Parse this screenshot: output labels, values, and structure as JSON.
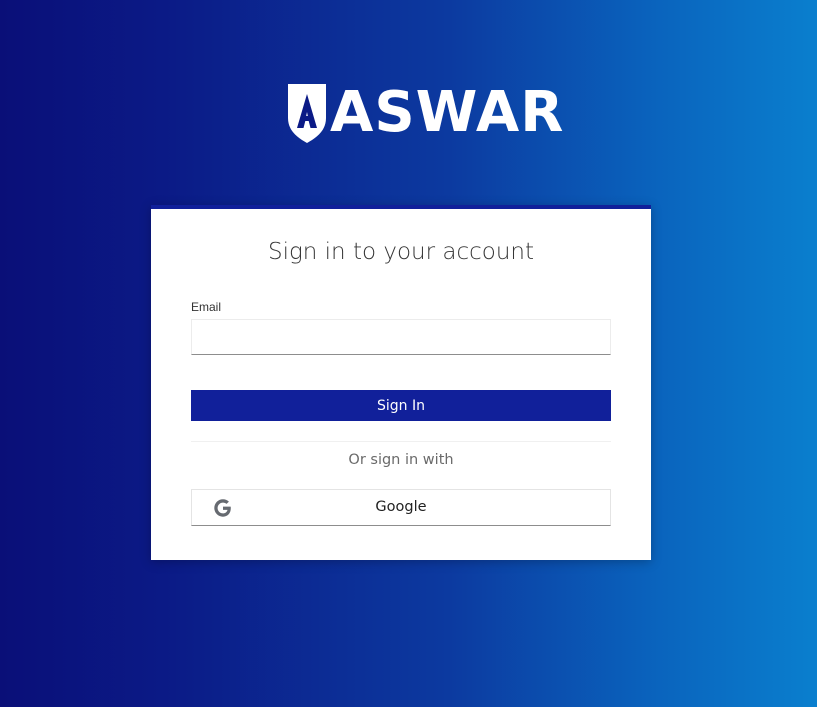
{
  "brand": {
    "name": "ASWAR",
    "shield_letter": "A"
  },
  "login": {
    "title": "Sign in to your account",
    "email_label": "Email",
    "email_value": "",
    "email_placeholder": "",
    "submit_label": "Sign In",
    "alt_label": "Or sign in with",
    "provider_label": "Google"
  },
  "colors": {
    "primary": "#11209a",
    "background_start": "#0a0f78",
    "background_end": "#0a7fce",
    "card": "#ffffff"
  },
  "icons": {
    "provider": "google-g-icon",
    "logo": "shield-icon"
  }
}
